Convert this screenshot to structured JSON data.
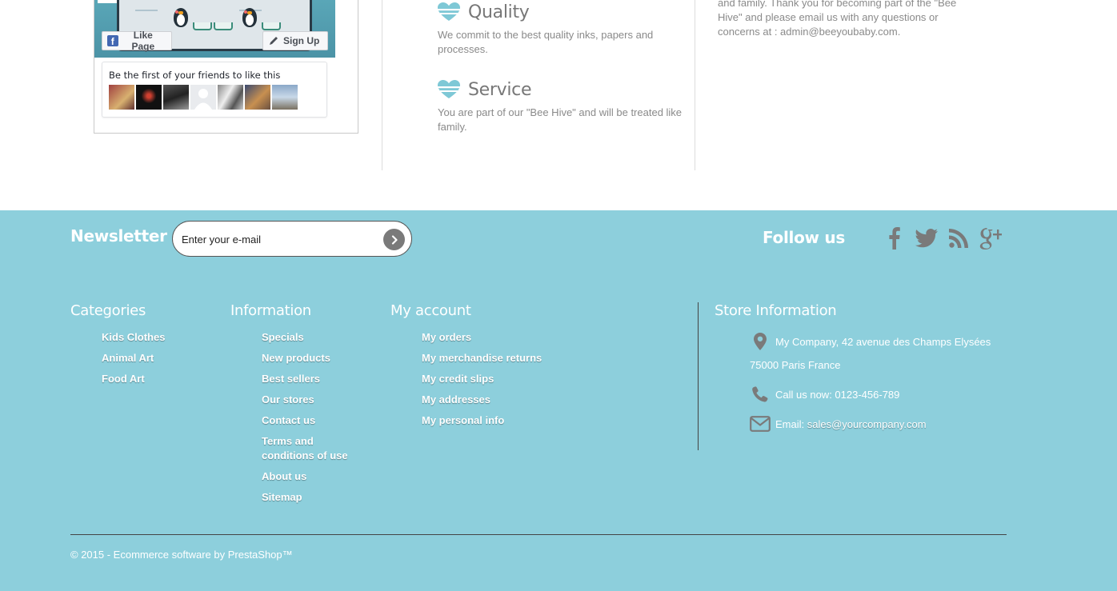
{
  "facebook_widget": {
    "like_label": "Like Page",
    "signup_label": "Sign Up",
    "friends_text": "Be the first of your friends to like this",
    "facebook_letter": "f"
  },
  "features": {
    "quality": {
      "title": "Quality",
      "description": "We commit to the best quality inks, papers and processes."
    },
    "service": {
      "title": "Service",
      "description": "You are part of our \"Bee Hive\" and will be treated like family."
    }
  },
  "about": {
    "text": "and family. Thank you for becoming part of the \"Bee Hive\" and please email us with any questions or concerns at : admin@beeyoubaby.com."
  },
  "newsletter": {
    "title": "Newsletter",
    "placeholder": "Enter your e-mail"
  },
  "follow": {
    "title": "Follow us",
    "icons": [
      "facebook-icon",
      "twitter-icon",
      "rss-icon",
      "google-plus-icon"
    ]
  },
  "categories": {
    "title": "Categories",
    "items": [
      "Kids Clothes",
      "Animal Art",
      "Food Art"
    ]
  },
  "information": {
    "title": "Information",
    "items": [
      "Specials",
      "New products",
      "Best sellers",
      "Our stores",
      "Contact us",
      "Terms and conditions of use",
      "About us",
      "Sitemap"
    ]
  },
  "account": {
    "title": "My account",
    "items": [
      "My orders",
      "My merchandise returns",
      "My credit slips",
      "My addresses",
      "My personal info"
    ]
  },
  "store": {
    "title": "Store Information",
    "address": "My Company, 42 avenue des Champs Elysées",
    "city": "75000 Paris France",
    "phone_label": "Call us now: ",
    "phone": "0123-456-789",
    "email_label": "Email: ",
    "email": "sales@yourcompany.com"
  },
  "copyright": "© 2015 - Ecommerce software by PrestaShop™",
  "colors": {
    "footer_bg": "#8dcfdc",
    "icon_gray": "#7a7a7a",
    "heart_accent": "#7ec8d6"
  }
}
